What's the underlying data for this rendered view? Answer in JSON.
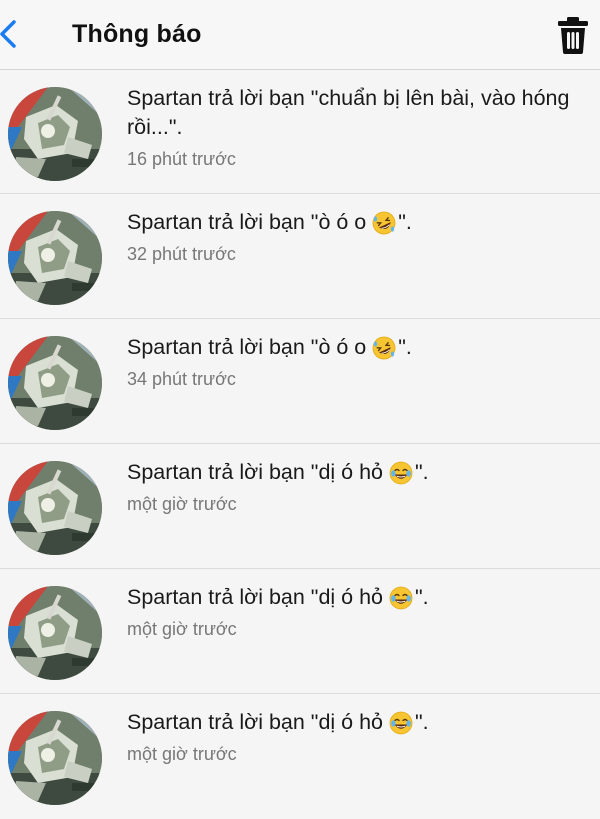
{
  "header": {
    "title": "Thông báo",
    "back_icon": "chevron-left-icon",
    "delete_icon": "trash-icon",
    "accent_color": "#1a7cf5"
  },
  "notifications": [
    {
      "text": "Spartan trả lời bạn \"chuẩn bị lên bài, vào hóng rồi...\".",
      "emoji": null,
      "time": "16 phút trước"
    },
    {
      "text": "Spartan trả lời bạn \"ò ó o",
      "emoji": "rolling-laughing-emoji",
      "suffix": "\".",
      "time": "32 phút trước"
    },
    {
      "text": "Spartan trả lời bạn \"ò ó o",
      "emoji": "rolling-laughing-emoji",
      "suffix": "\".",
      "time": "34 phút trước"
    },
    {
      "text": "Spartan trả lời bạn \"dị ó hỏ",
      "emoji": "tears-of-joy-emoji",
      "suffix": "\".",
      "time": "một giờ trước"
    },
    {
      "text": "Spartan trả lời bạn \"dị ó hỏ",
      "emoji": "tears-of-joy-emoji",
      "suffix": "\".",
      "time": "một giờ trước"
    },
    {
      "text": "Spartan trả lời bạn \"dị ó hỏ",
      "emoji": "tears-of-joy-emoji",
      "suffix": "\".",
      "time": "một giờ trước"
    }
  ]
}
